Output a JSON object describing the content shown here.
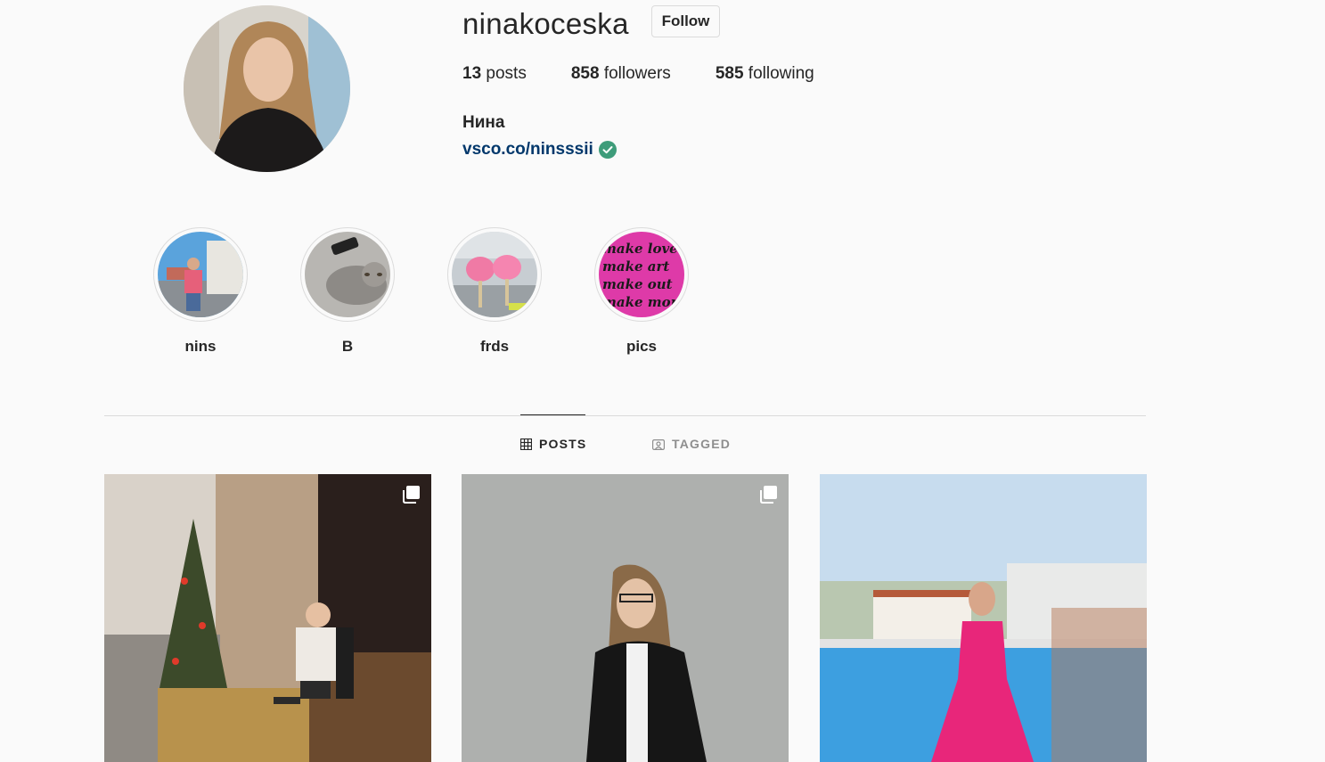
{
  "profile": {
    "username": "ninakoceska",
    "follow_label": "Follow",
    "posts_count": "13",
    "posts_label": "posts",
    "followers_count": "858",
    "followers_label": "followers",
    "following_count": "585",
    "following_label": "following",
    "full_name": "Нина",
    "bio_link": "vsco.co/ninsssii"
  },
  "highlights": [
    {
      "label": "nins"
    },
    {
      "label": "B"
    },
    {
      "label": "frds"
    },
    {
      "label": "pics",
      "text_lines": [
        "make love",
        "make art",
        "make out",
        "make money"
      ]
    }
  ],
  "tabs": [
    {
      "label": "POSTS",
      "icon": "grid-icon",
      "active": true
    },
    {
      "label": "TAGGED",
      "icon": "tagged-icon",
      "active": false
    }
  ],
  "posts": [
    {
      "icon": "multiple-posts-icon"
    },
    {
      "icon": "multiple-posts-icon"
    },
    {}
  ],
  "colors": {
    "link": "#00376b",
    "verified": "#3e9c7a",
    "text": "#262626",
    "muted": "#8e8e8e",
    "border": "#dbdbdb"
  }
}
